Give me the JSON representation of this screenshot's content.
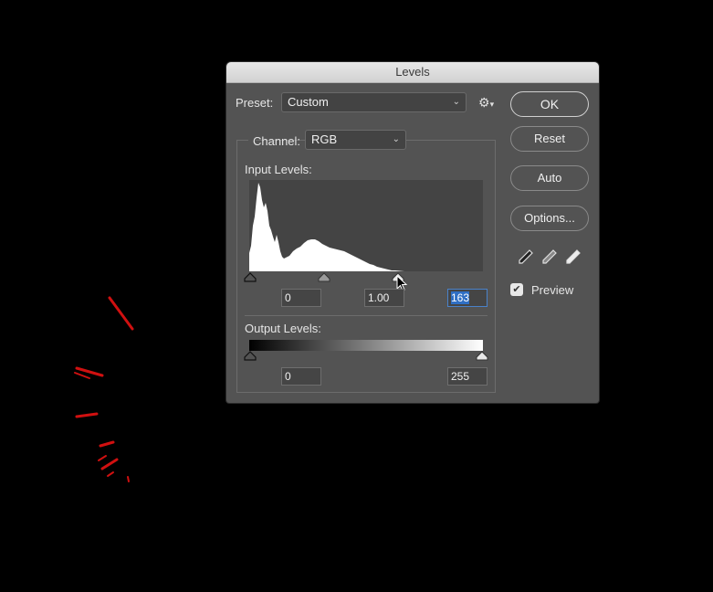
{
  "dialog": {
    "title": "Levels",
    "preset": {
      "label": "Preset:",
      "value": "Custom"
    },
    "settings_icon": "gear-icon",
    "channel": {
      "label": "Channel:",
      "value": "RGB"
    },
    "input_levels": {
      "label": "Input Levels:",
      "black": "0",
      "gamma": "1.00",
      "white": "163"
    },
    "output_levels": {
      "label": "Output Levels:",
      "black": "0",
      "white": "255"
    },
    "buttons": {
      "ok": "OK",
      "reset": "Reset",
      "auto": "Auto",
      "options": "Options..."
    },
    "eyedroppers": [
      "black-point-eyedropper",
      "gray-point-eyedropper",
      "white-point-eyedropper"
    ],
    "preview": {
      "label": "Preview",
      "checked": true
    }
  },
  "colors": {
    "dialog_bg": "#535353",
    "histogram_bg": "#444444",
    "selection": "#2f6fc4",
    "canvas_marks": "#d01010"
  }
}
